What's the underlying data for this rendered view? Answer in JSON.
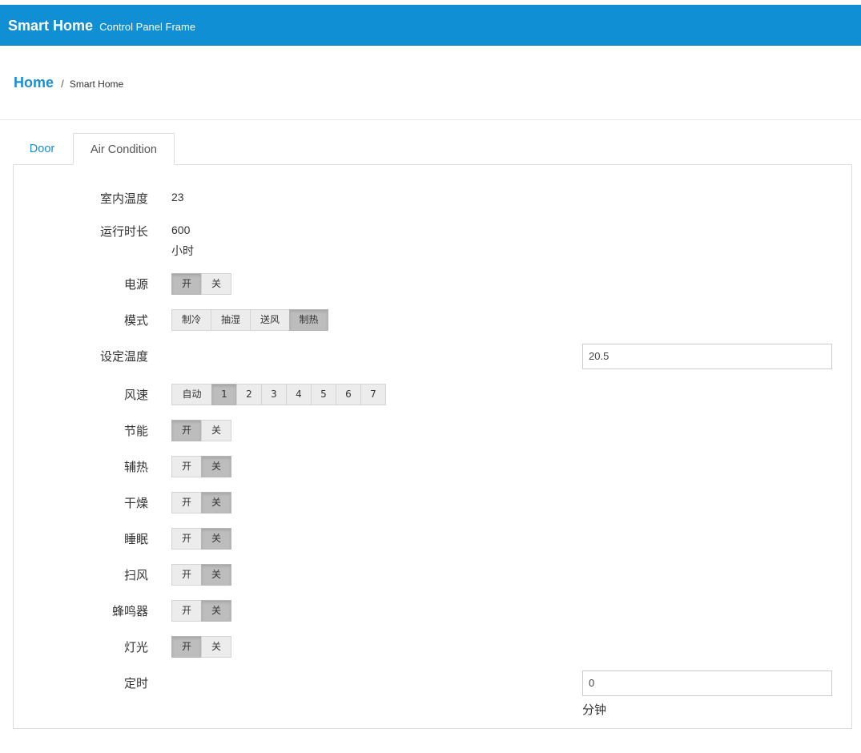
{
  "header": {
    "brand_bold": "Smart Home",
    "brand_sub": "Control Panel Frame"
  },
  "breadcrumb": {
    "home": "Home",
    "separator": "/",
    "current": "Smart Home"
  },
  "tabs": [
    {
      "label": "Door",
      "active": false
    },
    {
      "label": "Air Condition",
      "active": true
    }
  ],
  "ac": {
    "indoor_temp": {
      "label": "室内温度",
      "value": "23"
    },
    "runtime": {
      "label": "运行时长",
      "value": "600",
      "unit": "小时"
    },
    "power": {
      "label": "电源",
      "on": "开",
      "off": "关",
      "selected": "开"
    },
    "mode": {
      "label": "模式",
      "options": [
        "制冷",
        "抽湿",
        "送风",
        "制热"
      ],
      "selected": "制热"
    },
    "set_temp": {
      "label": "设定温度",
      "value": "20.5"
    },
    "fan_speed": {
      "label": "风速",
      "options": [
        "自动",
        "1",
        "2",
        "3",
        "4",
        "5",
        "6",
        "7"
      ],
      "selected": "1"
    },
    "eco": {
      "label": "节能",
      "on": "开",
      "off": "关",
      "selected": "开"
    },
    "aux_heat": {
      "label": "辅热",
      "on": "开",
      "off": "关",
      "selected": "关"
    },
    "dry": {
      "label": "干燥",
      "on": "开",
      "off": "关",
      "selected": "关"
    },
    "sleep": {
      "label": "睡眠",
      "on": "开",
      "off": "关",
      "selected": "关"
    },
    "swing": {
      "label": "扫风",
      "on": "开",
      "off": "关",
      "selected": "关"
    },
    "buzzer": {
      "label": "蜂鸣器",
      "on": "开",
      "off": "关",
      "selected": "关"
    },
    "light": {
      "label": "灯光",
      "on": "开",
      "off": "关",
      "selected": "开"
    },
    "timer": {
      "label": "定时",
      "value": "0",
      "unit": "分钟"
    }
  }
}
